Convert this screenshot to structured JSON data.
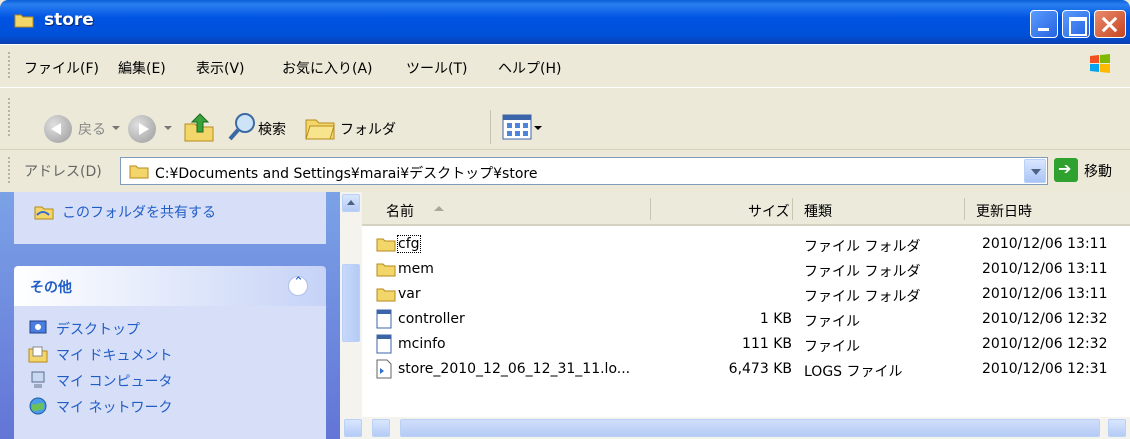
{
  "window": {
    "title": "store"
  },
  "menu": {
    "items": [
      "ファイル(F)",
      "編集(E)",
      "表示(V)",
      "お気に入り(A)",
      "ツール(T)",
      "ヘルプ(H)"
    ]
  },
  "toolbar": {
    "back_label": "戻る",
    "search_label": "検索",
    "folders_label": "フォルダ"
  },
  "address": {
    "label": "アドレス(D)",
    "path": "C:¥Documents and Settings¥marai¥デスクトップ¥store",
    "go_label": "移動"
  },
  "taskpane": {
    "share_link": "このフォルダを共有する",
    "other_title": "その他",
    "other_links": [
      "デスクトップ",
      "マイ ドキュメント",
      "マイ コンピュータ",
      "マイ ネットワーク"
    ]
  },
  "filelist": {
    "columns": {
      "name": "名前",
      "size": "サイズ",
      "type": "種類",
      "modified": "更新日時"
    },
    "rows": [
      {
        "name": "cfg",
        "size": "",
        "type": "ファイル フォルダ",
        "modified": "2010/12/06 13:11",
        "icon": "folder-icon"
      },
      {
        "name": "mem",
        "size": "",
        "type": "ファイル フォルダ",
        "modified": "2010/12/06 13:11",
        "icon": "folder-icon"
      },
      {
        "name": "var",
        "size": "",
        "type": "ファイル フォルダ",
        "modified": "2010/12/06 13:11",
        "icon": "folder-icon"
      },
      {
        "name": "controller",
        "size": "1 KB",
        "type": "ファイル",
        "modified": "2010/12/06 12:32",
        "icon": "file-icon"
      },
      {
        "name": "mcinfo",
        "size": "111 KB",
        "type": "ファイル",
        "modified": "2010/12/06 12:32",
        "icon": "file-icon"
      },
      {
        "name": "store_2010_12_06_12_31_11.lo...",
        "size": "6,473 KB",
        "type": "LOGS ファイル",
        "modified": "2010/12/06 12:31",
        "icon": "log-file-icon"
      }
    ]
  },
  "colors": {
    "title_bar": "#0054e3",
    "task_pane": "#6375d6",
    "link": "#215dc6"
  }
}
